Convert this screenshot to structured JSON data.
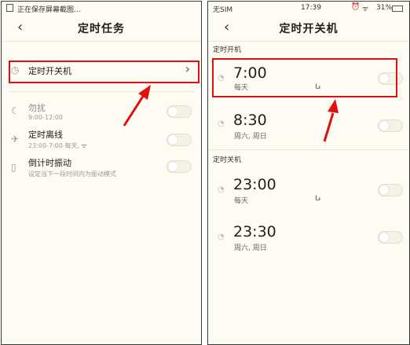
{
  "left": {
    "status": {
      "text": "正在保存屏幕截图..."
    },
    "header": {
      "back": "‹",
      "title": "定时任务"
    },
    "items": [
      {
        "title": "定时开关机",
        "chevron": "›",
        "icon": "clock-icon"
      },
      {
        "title": "勿扰",
        "sub": "9:00-12:00",
        "icon": "moon-icon"
      },
      {
        "title": "定时离线",
        "sub": "23:00-7:00 每天, ",
        "icon": "airplane-icon"
      },
      {
        "title": "倒计时振动",
        "sub": "设定当下一段时间内为振动模式",
        "icon": "phone-vibrate-icon"
      }
    ]
  },
  "right": {
    "status": {
      "carrier": "无SIM",
      "time": "17:39",
      "battery": "31%"
    },
    "header": {
      "back": "‹",
      "title": "定时开关机"
    },
    "sections": [
      {
        "label": "定时开机",
        "alarms": [
          {
            "time": "7:00",
            "days": "每天"
          },
          {
            "time": "8:30",
            "days": "周六, 周日"
          }
        ]
      },
      {
        "label": "定时关机",
        "alarms": [
          {
            "time": "23:00",
            "days": "每天"
          },
          {
            "time": "23:30",
            "days": "周六, 周日"
          }
        ]
      }
    ]
  },
  "colors": {
    "highlight": "#e01010",
    "background": "#fdfbf2"
  }
}
